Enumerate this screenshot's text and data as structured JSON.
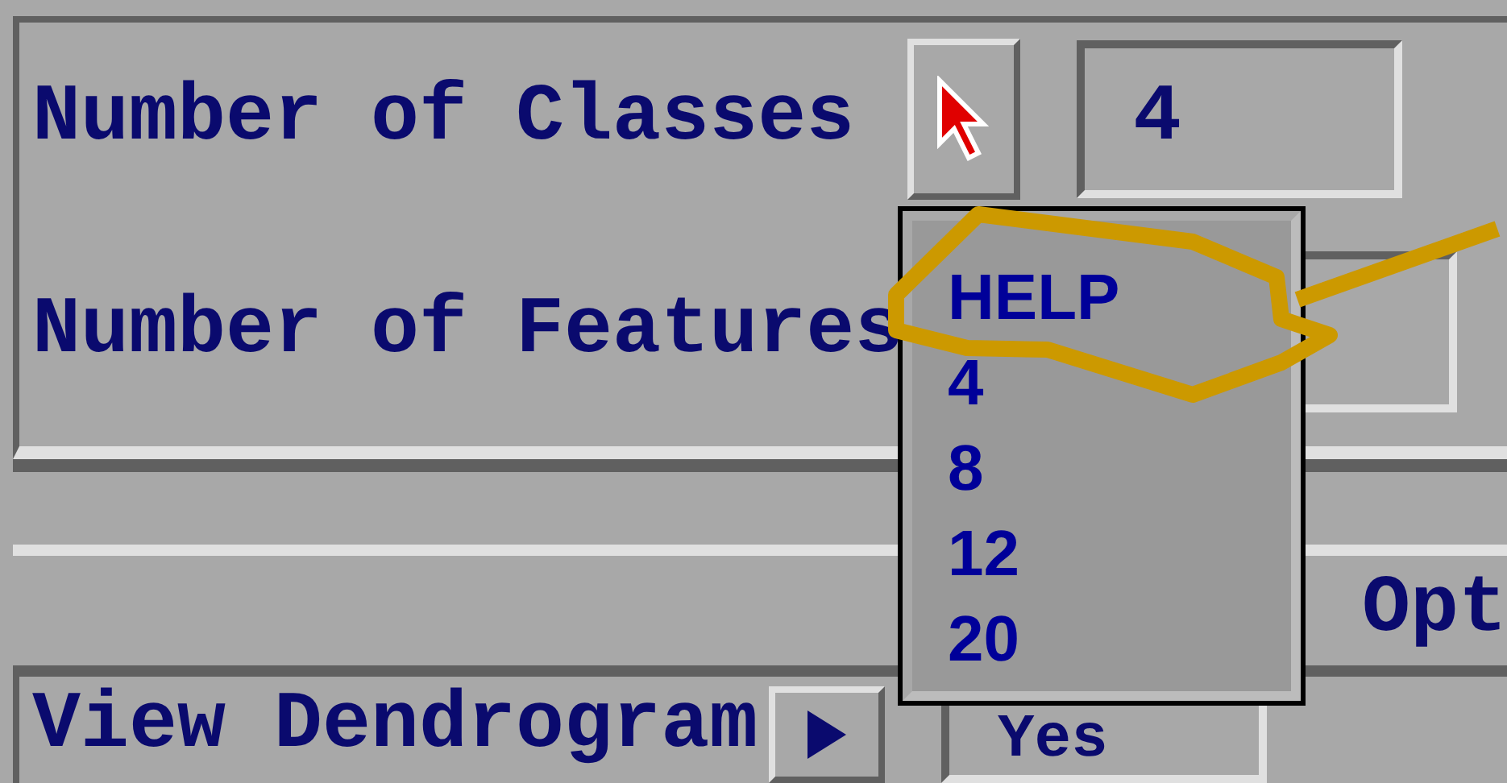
{
  "fields": [
    {
      "label": "Number of Classes",
      "value": "4"
    },
    {
      "label": "Number of Features"
    }
  ],
  "option_label": "Opt",
  "dendrogram": {
    "label": "View Dendrogram",
    "value": "Yes"
  },
  "dropdown": {
    "items": [
      {
        "label": "HELP"
      },
      {
        "label": "4"
      },
      {
        "label": "8"
      },
      {
        "label": "12"
      },
      {
        "label": "20"
      }
    ]
  }
}
